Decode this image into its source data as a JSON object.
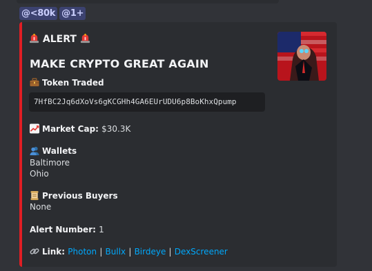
{
  "mentions": [
    "@<80k",
    "@1+"
  ],
  "colors": {
    "accent_bar": "#e01e24",
    "link": "#00a8fc",
    "mention_bg": "#3c4270"
  },
  "embed": {
    "alert_title": "ALERT",
    "headline": "MAKE CRYPTO GREAT AGAIN",
    "token_traded_label": "Token Traded",
    "token_address": "7HfBC2Jq6dXoVs6gKCGHh4GA6EUrUDU6p8BoKhxQpump",
    "market_cap_label": "Market Cap:",
    "market_cap_value": "$30.3K",
    "wallets_label": "Wallets",
    "wallets": [
      "Baltimore",
      "Ohio"
    ],
    "previous_buyers_label": "Previous Buyers",
    "previous_buyers_value": "None",
    "alert_number_label": "Alert Number:",
    "alert_number_value": "1",
    "link_label": "Link:",
    "links": [
      "Photon",
      "Bullx",
      "Birdeye",
      "DexScreener"
    ],
    "icons": [
      "siren-icon",
      "briefcase-icon",
      "chart-up-icon",
      "users-icon",
      "scroll-icon",
      "link-icon"
    ]
  }
}
